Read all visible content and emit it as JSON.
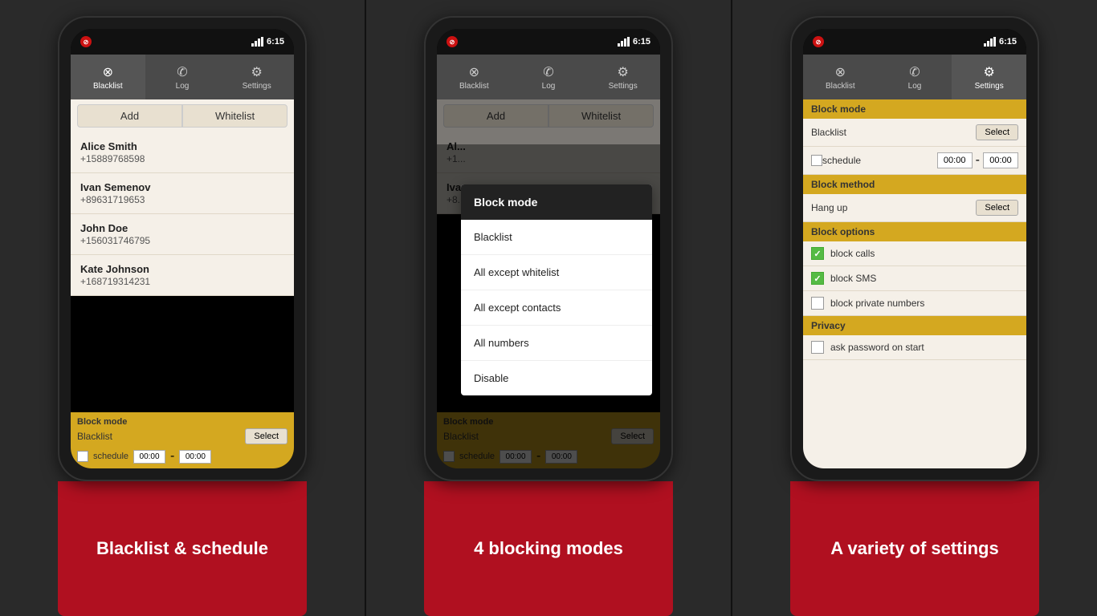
{
  "background_color": "#2a2a2a",
  "phones": [
    {
      "id": "phone1",
      "status_bar": {
        "left_icon": "no-entry",
        "signal": "▂▄▆",
        "time": "6:15"
      },
      "tabs": [
        {
          "label": "Blacklist",
          "icon": "⊗",
          "active": true
        },
        {
          "label": "Log",
          "icon": "📞"
        },
        {
          "label": "Settings",
          "icon": "⚙"
        }
      ],
      "buttons": [
        "Add",
        "Whitelist"
      ],
      "contacts": [
        {
          "name": "Alice Smith",
          "number": "+15889768598"
        },
        {
          "name": "Ivan Semenov",
          "number": "+89631719653"
        },
        {
          "name": "John Doe",
          "number": "+156031746795"
        },
        {
          "name": "Kate Johnson",
          "number": "+168719314231"
        }
      ],
      "bottom": {
        "section_label": "Block mode",
        "value": "Blacklist",
        "select_label": "Select",
        "schedule_label": "schedule",
        "time1": "00:00",
        "dash": "-",
        "time2": "00:00"
      },
      "caption": "Blacklist & schedule"
    },
    {
      "id": "phone2",
      "status_bar": {
        "time": "6:15"
      },
      "tabs": [
        {
          "label": "Blacklist",
          "icon": "⊗"
        },
        {
          "label": "Log",
          "icon": "📞"
        },
        {
          "label": "Settings",
          "icon": "⚙"
        }
      ],
      "contacts_partial": [
        {
          "name": "Al...",
          "number": "+1..."
        },
        {
          "name": "Iva...",
          "number": "+8..."
        }
      ],
      "popup": {
        "header": "Block mode",
        "items": [
          "Blacklist",
          "All except whitelist",
          "All except contacts",
          "All numbers",
          "Disable"
        ]
      },
      "bottom": {
        "section_label": "Block mode",
        "value": "Blacklist",
        "select_label": "Select",
        "schedule_label": "schedule",
        "time1": "00:00",
        "dash": "-",
        "time2": "00:00"
      },
      "caption": "4 blocking modes"
    },
    {
      "id": "phone3",
      "status_bar": {
        "time": "6:15"
      },
      "tabs": [
        {
          "label": "Blacklist",
          "icon": "⊗"
        },
        {
          "label": "Log",
          "icon": "📞"
        },
        {
          "label": "Settings",
          "icon": "⚙",
          "active": true
        }
      ],
      "settings": {
        "sections": [
          {
            "title": "Block mode",
            "rows": [
              {
                "type": "select",
                "label": "Blacklist",
                "btn": "Select"
              },
              {
                "type": "schedule",
                "label": "schedule",
                "time1": "00:00",
                "dash": "-",
                "time2": "00:00"
              }
            ]
          },
          {
            "title": "Block method",
            "rows": [
              {
                "type": "select",
                "label": "Hang up",
                "btn": "Select"
              }
            ]
          },
          {
            "title": "Block options",
            "rows": [
              {
                "type": "checkbox",
                "checked": true,
                "label": "block calls"
              },
              {
                "type": "checkbox",
                "checked": true,
                "label": "block SMS"
              },
              {
                "type": "checkbox",
                "checked": false,
                "label": "block private numbers"
              }
            ]
          },
          {
            "title": "Privacy",
            "rows": [
              {
                "type": "checkbox",
                "checked": false,
                "label": "ask password on start"
              }
            ]
          }
        ]
      },
      "caption": "A variety of settings"
    }
  ]
}
